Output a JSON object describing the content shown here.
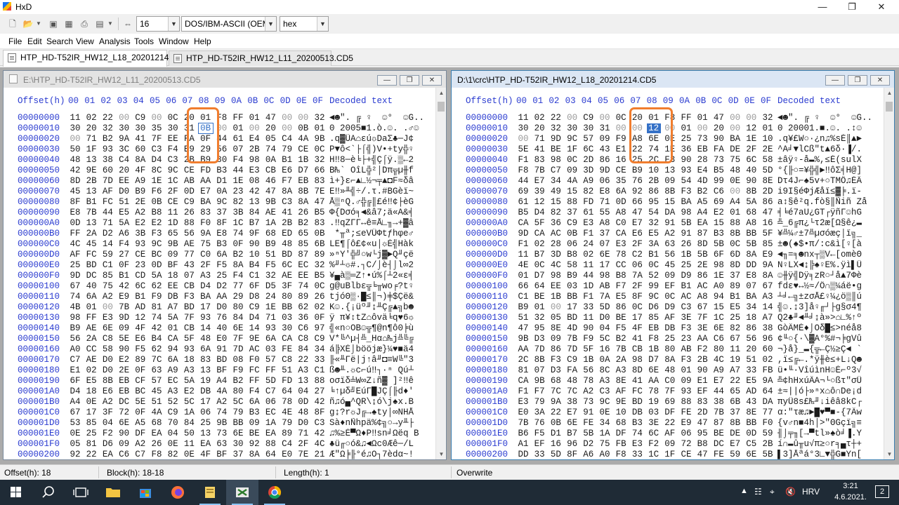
{
  "window": {
    "title": "HxD"
  },
  "toolbar": {
    "bytes_per_row": "16",
    "charset": "DOS/IBM-ASCII (OEM)",
    "offset_base": "hex"
  },
  "menu": [
    "File",
    "Edit",
    "Search",
    "View",
    "Analysis",
    "Tools",
    "Window",
    "Help"
  ],
  "tabs": [
    {
      "label": "HTP_HD-T52IR_HW12_L18_20201214.CD5",
      "active": true
    },
    {
      "label": "HTP_HD-T52IR_HW12_L11_20200513.CD5",
      "active": false
    }
  ],
  "header": {
    "offset": "Offset(h)",
    "columns": [
      "00",
      "01",
      "02",
      "03",
      "04",
      "05",
      "06",
      "07",
      "08",
      "09",
      "0A",
      "0B",
      "0C",
      "0D",
      "0E",
      "0F"
    ],
    "decoded": "Decoded text"
  },
  "panels": [
    {
      "title": "E:\\HTP_HD-T52IR_HW12_L11_20200513.CD5",
      "active": false,
      "selected_offset": "00000018",
      "rows": [
        {
          "off": "00000000",
          "bytes": "11 02 22 00 C9 00 0C 20 01 F8 FF 01 47 00 00 32",
          "dec": "◄☻\". ╔ ♀  ☺°  ☺G..2"
        },
        {
          "off": "00000010",
          "bytes": "30 20 32 30 30 35 30 31 0B 00 01 00 20 00 0B 01",
          "dec": "0 2005■1.ò.☺. .♂☺"
        },
        {
          "off": "00000020",
          "bytes": "00 71 B2 9A 41 7F EE FA 0F 44 61 E4 05 C4 4A 9B",
          "dec": ".q▓ÜA⌂εú☼DaΣ♣─J¢"
        },
        {
          "off": "00000030",
          "bytes": "50 1F 93 3C 60 C3 F4 B9 29 56 07 2B 74 79 CE 0C",
          "dec": "P▼ô<`├⌠╣)V•+ty╬♀"
        },
        {
          "off": "00000040",
          "bytes": "48 13 38 C4 8A D4 C3 2B B9 80 F4 98 0A B1 1B 32",
          "dec": "H‼8─è╘├+╣Ç⌠ÿ.▒←2"
        },
        {
          "off": "00000050",
          "bytes": "42 9E 60 20 4F 8C 9C CE FD B3 44 E3 CB E6 D7 66",
          "dec": "B₧` OîL╬²│Dπ╦µ╫f"
        },
        {
          "off": "00000060",
          "bytes": "8D 2B 7D EE A9 1E 1C AB AA D1 1E 08 46 F7 EB 83",
          "dec": "ì+}ε⌐▲∟½¬╤▲◘F≈δâ"
        },
        {
          "off": "00000070",
          "bytes": "45 13 AF D0 B9 F6 2F 0D E7 0A 23 42 47 8A 8B 7E",
          "dec": "E‼»╨╣÷/.τ.#BGèï~"
        },
        {
          "off": "00000080",
          "bytes": "8F B1 FC 51 2E 0B CE C9 BA 9C 82 13 9B C3 8A 47",
          "dec": "Å▒ⁿQ.♂╬╔║£é‼¢├èG"
        },
        {
          "off": "00000090",
          "bytes": "E8 7B 44 E5 A2 B8 11 26 83 37 3B 84 AE 41 26 B5",
          "dec": "Φ{Dσó╕◄&â7;ä«A&╡"
        },
        {
          "off": "000000A0",
          "bytes": "0D 13 71 5A E2 E2 1D 88 F0 8F 1C B7 1A 2B B2 83",
          "dec": ".‼qZΓΓ↔ê≡Å∟╖→+▓â"
        },
        {
          "off": "000000B0",
          "bytes": "FF 2A D2 A6 3B F3 65 56 9A E8 74 9F 68 ED 65 0B",
          "dec": " *╥ª;≤eVÜΦtƒhφe♂"
        },
        {
          "off": "000000C0",
          "bytes": "4C 45 14 F4 93 9C 9B AE 75 B3 0F 90 B9 48 85 6B",
          "dec": "LE¶⌠ô£¢«u│☼É╣Hàk"
        },
        {
          "off": "000000D0",
          "bytes": "AF FC 59 27 CE BC 09 77 C0 6A B2 10 51 BD 87 89",
          "dec": "»ⁿY'╬╝○w└j▓►Q╜çë"
        },
        {
          "off": "000000E0",
          "bytes": "25 BD C1 0F 23 0D BF 43 2F F5 8A B4 F5 6C EC 32",
          "dec": "%╜┴☼#.┐C/⌡è┤⌡l∞2"
        },
        {
          "off": "000000F0",
          "bytes": "9D DC 85 B1 CD 5A 18 07 A3 25 F4 C1 32 AE EE B5",
          "dec": "¥▄à▒═Z↑•ú%⌠┴2«ε╡"
        },
        {
          "off": "00000100",
          "bytes": "67 40 75 42 6C 62 EE CB D4 D2 77 6F D5 3F 74 0C",
          "dec": "g@uBlbε╦╘╥wo╒?t♀"
        },
        {
          "off": "00000110",
          "bytes": "74 6A A2 E9 B1 F9 DB F3 BA AA 29 D8 24 80 89 26",
          "dec": "tjóΘ▒∙█≤║¬)╪$Çë&"
        },
        {
          "off": "00000120",
          "bytes": "4B 01 00 7B AD 81 A7 BD 17 D0 80 C9 1E BB 62 02",
          "dec": "K☺.{¡üº╜↨╨Ç╔▲╗b☻"
        },
        {
          "off": "00000130",
          "bytes": "98 FF E3 9D 12 74 5A 7F 93 76 84 D4 71 03 36 0F",
          "dec": "ÿ π¥↕tZ⌂ôvä╘q♥6☼"
        },
        {
          "off": "00000140",
          "bytes": "B9 AE 6E 09 4F 42 01 CB 14 40 6E 14 93 30 C6 97",
          "dec": "╣«n○OB☺╦¶@n¶ô0╞ù"
        },
        {
          "off": "00000150",
          "bytes": "56 2A C8 5E E6 B4 CA 5F 48 E0 7F 9E 6A CA C8 C9",
          "dec": "V*╚^µ┤╩_Hα⌂₧j╩╚╔"
        },
        {
          "off": "00000160",
          "bytes": "A0 CC 58 90 F5 62 94 93 6A 91 7D AC 03 FE 84 34",
          "dec": "á╠XÉ⌡bööjæ}¼♥■ä4"
        },
        {
          "off": "00000170",
          "bytes": "C7 AE D0 E2 89 7C 6A 18 83 BD 08 F0 57 C8 22 33",
          "dec": "╟«╨Γë|j↑â╜◘≡W╚\"3"
        },
        {
          "off": "00000180",
          "bytes": "E1 02 D0 2E 0F 63 A9 A3 13 BF F9 FC FF 51 A3 C1",
          "dec": "ß☻╨.☼c⌐ú‼┐∙ⁿ Qú┴"
        },
        {
          "off": "00000190",
          "bytes": "6F E5 8B EB CF 57 EC 5A 19 A4 B2 FF 5D FD 13 88",
          "dec": "oσïδ╧W∞Z↓ñ▓ ]²‼ê"
        },
        {
          "off": "000001A0",
          "bytes": "D4 18 E6 EB BC 45 A3 E2 DB 4A 80 F4 C7 64 04 27",
          "dec": "╘↑µδ╝EúΓ█JÇ⌠╟d♦'"
        },
        {
          "off": "000001B0",
          "bytes": "A4 0E A2 DC 5E 51 52 5C 17 A2 5C 6A 06 78 0D 42",
          "dec": "ñ♫ó▄^QR\\↨ó\\j♠x.B"
        },
        {
          "off": "000001C0",
          "bytes": "67 17 3F 72 0F 4A C9 1A 06 74 79 B3 EC 4E 48 8F",
          "dec": "g↨?r☼J╔→♠ty│∞NHÅ"
        },
        {
          "off": "000001D0",
          "bytes": "53 85 04 6E A5 68 70 84 25 9B BB 09 1A 79 D0 C3",
          "dec": "Sà♦nÑhpä%¢╗○→y╨├"
        },
        {
          "off": "000001E0",
          "bytes": "0E 25 F2 90 DF EA 04 50 13 73 6E BE EA 89 71 42",
          "dec": "♫%≥É▀Ω♦P‼sn╛Ωëq B"
        },
        {
          "off": "000001F0",
          "bytes": "05 81 D6 09 A2 26 0E 11 EA 63 30 92 88 C4 2F 4C",
          "dec": "♣ü╓○ó&♫◄Ωc0Æê─/L"
        },
        {
          "off": "00000200",
          "bytes": "92 22 EA C6 C7 F8 82 0E 4F BF 37 8A 64 E0 7E 21",
          "dec": "Æ\"Ω╞╟°é♫O┐7èdα~!"
        }
      ]
    },
    {
      "title": "D:\\1\\crc\\HTP_HD-T52IR_HW12_L18_20201214.CD5",
      "active": true,
      "selected_offset": "00000018",
      "rows": [
        {
          "off": "00000000",
          "bytes": "11 02 22 00 C9 00 0C 20 01 F8 FF 01 47 00 00 32",
          "dec": "◄☻\". ╔ ♀  ☺°  ☺G..2"
        },
        {
          "off": "00000010",
          "bytes": "30 20 32 30 30 31 00 00 12 00 01 00 20 00 12 01",
          "dec": "0 20001.■.☺. .↕☺"
        },
        {
          "off": "00000020",
          "bytes": "00 71 9D 9C 57 09 F9 A8 6E 0E 25 73 90 BA 1E 10",
          "dec": ".q¥£W○∙¿n♫%sÉ║▲►"
        },
        {
          "off": "00000030",
          "bytes": "5E 41 BE 1F 6C 43 E1 22 74 1E 36 EB FA DE 2F 2E",
          "dec": "^A╛▼lCß\"t▲6δ·▐/."
        },
        {
          "off": "00000040",
          "bytes": "F1 83 98 0C 2D 86 16 25 2C F3 90 28 73 75 6C 58",
          "dec": "±âÿ♀-å▬%,≤É(sulX"
        },
        {
          "off": "00000050",
          "bytes": "F8 7B C7 09 3D 9D CE B9 10 13 93 E4 B5 48 40 5D",
          "dec": "°{╟○=¥╬╣►‼ôΣ╡H@]"
        },
        {
          "off": "00000060",
          "bytes": "44 E7 34 4A A9 06 35 76 2B 09 54 4D 99 0E 90 8E",
          "dec": "Dτ4J⌐♠5v+○TMÖ♫ÉÄ"
        },
        {
          "off": "00000070",
          "bytes": "69 39 49 15 82 E8 6A 92 86 8B F3 B2 C6 00 8B 2D",
          "dec": "i9I§éΦjÆåï≤▓╞.ï-"
        },
        {
          "off": "00000080",
          "bytes": "61 12 15 88 FD 71 0D 66 95 15 BA A5 69 A4 5A 86",
          "dec": "a↕§ê²q.fò§║Ñiñ Zå"
        },
        {
          "off": "00000090",
          "bytes": "B5 D4 82 37 61 55 A8 47 54 DA 98 A4 E2 01 68 47",
          "dec": "╡╘é7aU¿GT┌ÿñΓ☺hG"
        },
        {
          "off": "000000A0",
          "bytes": "CA 5F 36 C9 E3 A8 C0 E7 32 91 5B EA 15 88 A8 16",
          "dec": "╩_6╔π¿└τ2æ[Ω§ê¿▬"
        },
        {
          "off": "000000B0",
          "bytes": "9D CA AC 0B F1 37 CA E6 E5 A2 91 87 B3 8B BB 5F",
          "dec": "¥╩¼♂±7╩µσóæç│ï╗_"
        },
        {
          "off": "000000C0",
          "bytes": "F1 02 28 06 24 07 E3 2F 3A 63 26 8D 5B 0C 5B 85",
          "dec": "±☻(♠$•π/:c&ì[♀[à"
        },
        {
          "off": "000000D0",
          "bytes": "11 B7 3D B8 02 6E 78 C2 B1 56 1B 5B 6F 6D 8A E9",
          "dec": "◄╖=╕☻nx┬▒V←[omèΘ"
        },
        {
          "off": "000000E0",
          "bytes": "4E 0C 4C 58 11 17 CC 06 0C 45 25 2E 98 8D DD 9A",
          "dec": "N♀LX◄↨╠♠♀E%.ÿì▌Ü"
        },
        {
          "off": "000000F0",
          "bytes": "01 D7 98 B9 44 98 B8 7A 52 09 D9 86 1E 37 E8 8A",
          "dec": "☺╫ÿ╣Dÿ╕zR○┘å▲7Φè"
        },
        {
          "off": "00000100",
          "bytes": "66 64 EE 03 1D AB F7 2F 99 EF B1 AC A0 89 07 67",
          "dec": "fdε♥↔½≈/Ö∩▒¼áë•g"
        },
        {
          "off": "00000110",
          "bytes": "C1 BE 1B BB F1 7A E5 8F 9C 0C AC A8 94 B1 BA A3",
          "dec": "┴╛←╗±zσÅ£♀¼¿ö▒║ú"
        },
        {
          "off": "00000120",
          "bytes": "B9 01 00 17 33 5D 86 0C D6 D9 C3 67 15 E5 34 14",
          "dec": "╣☺.↨3]å♀╓┘├g§σ4¶"
        },
        {
          "off": "00000130",
          "bytes": "51 32 05 BD 11 D0 BE 17 85 AF 3E 7F 1C 25 18 A7",
          "dec": "Q2♣╜◄╨╛↨à»>⌂∟%↑º"
        },
        {
          "off": "00000140",
          "bytes": "47 95 8E 4D 90 04 F5 4F EB DB F3 3E 6E 82 86 38",
          "dec": "GòÄMÉ♦⌡Oδ█≤>néå8"
        },
        {
          "off": "00000150",
          "bytes": "9B D3 09 7B F9 5C B2 41 F8 25 23 AA C6 67 56 96",
          "dec": "¢╙○{∙\\▓A°%#¬╞gVû"
        },
        {
          "off": "00000160",
          "bytes": "AA 7D 86 7D 5F 16 7B CB 1B 80 AB F2 80 11 20 60",
          "dec": "¬}å}_▬{╦←Ç½≥Ç◄ `"
        },
        {
          "off": "00000170",
          "bytes": "2C 8B F3 C9 1B 0A 2A 98 D7 8A F3 2B 4C 19 51 02",
          "dec": ",ï≤╔←.*ÿ╫è≤+L↓Q☻"
        },
        {
          "off": "00000180",
          "bytes": "81 07 D3 FA 56 8C A3 8D 6E 48 01 90 A9 A7 33 FB",
          "dec": "ü•╙·VîúìnH☺É⌐º3√"
        },
        {
          "off": "00000190",
          "bytes": "CA 9B 68 48 78 A3 8E 41 AA C0 09 E1 E7 22 E5 9A",
          "dec": "╩¢hHxúÄA¬└○ßτ\"σÜ"
        },
        {
          "off": "000001A0",
          "bytes": "F1 F7 7C 7C A2 C3 AF FC 78 7F 93 EF 44 65 AD 64",
          "dec": "±≈||ó├»ⁿx⌂ô∩De¡d"
        },
        {
          "off": "000001B0",
          "bytes": "E3 79 9A 38 73 9C 9E BD 19 69 88 83 38 6B 43 DA",
          "dec": "πyÜ8s£₧╜↓iêâ8kC┌"
        },
        {
          "off": "000001C0",
          "bytes": "E0 3A 22 E7 91 0E 10 DB 03 DF FE 2D 7B 37 8E 77",
          "dec": "α:\"τæ♫►█♥▀■-{7Äw"
        },
        {
          "off": "000001D0",
          "bytes": "7B 76 0B 6E FE 34 68 B3 3E 22 E9 47 87 8B BB F0",
          "dec": "{v♂n■4h│>\"ΘGçï╗≡"
        },
        {
          "off": "000001E0",
          "bytes": "B6 F5 D1 B7 5B 1A DF 74 6C AF 06 95 BE DE 0D 59",
          "dec": "╢⌡╤╖[→▀tl»♠ò╛▐.Y"
        },
        {
          "off": "000001F0",
          "bytes": "A1 EF 16 96 D2 75 FB E3 F2 09 72 B8 DC E7 C5 2B",
          "dec": "í∩▬û╥u√π≥○r╕▄τ┼+"
        },
        {
          "off": "00000200",
          "bytes": "DD 33 5D 8F A6 A0 F8 33 1C 1F CE 47 FE 59 6E 5B",
          "dec": "▌3]Åªá°3∟▼╬G■Yn["
        }
      ]
    }
  ],
  "statusbar": {
    "offset": "Offset(h): 18",
    "block": "Block(h): 18-18",
    "length": "Length(h): 1",
    "mode": "Overwrite"
  },
  "taskbar": {
    "lang": "HRV",
    "time": "3:21",
    "date": "4.6.2021.",
    "notifications": "2"
  }
}
